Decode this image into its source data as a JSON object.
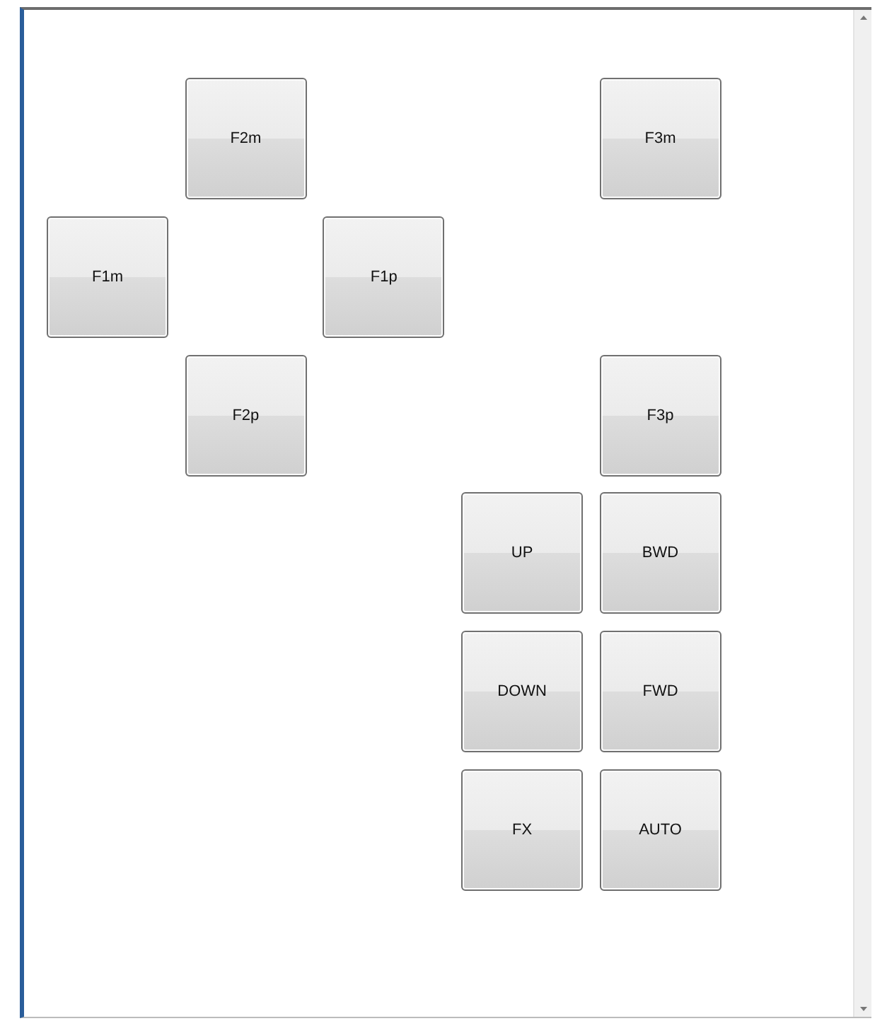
{
  "grid": [
    [
      {
        "kind": "empty"
      },
      {
        "kind": "button",
        "label": "F2m"
      },
      {
        "kind": "empty"
      },
      {
        "kind": "empty"
      },
      {
        "kind": "button",
        "label": "F3m"
      }
    ],
    [
      {
        "kind": "button",
        "label": "F1m"
      },
      {
        "kind": "empty"
      },
      {
        "kind": "button",
        "label": "F1p"
      },
      {
        "kind": "empty"
      },
      {
        "kind": "empty"
      }
    ],
    [
      {
        "kind": "empty"
      },
      {
        "kind": "button",
        "label": "F2p"
      },
      {
        "kind": "empty"
      },
      {
        "kind": "empty"
      },
      {
        "kind": "button",
        "label": "F3p"
      }
    ],
    [
      {
        "kind": "empty"
      },
      {
        "kind": "empty"
      },
      {
        "kind": "empty"
      },
      {
        "kind": "button",
        "label": "UP"
      },
      {
        "kind": "button",
        "label": "BWD"
      }
    ],
    [
      {
        "kind": "empty"
      },
      {
        "kind": "empty"
      },
      {
        "kind": "empty"
      },
      {
        "kind": "button",
        "label": "DOWN"
      },
      {
        "kind": "button",
        "label": "FWD"
      }
    ],
    [
      {
        "kind": "empty"
      },
      {
        "kind": "empty"
      },
      {
        "kind": "empty"
      },
      {
        "kind": "button",
        "label": "FX"
      },
      {
        "kind": "button",
        "label": "AUTO"
      }
    ]
  ]
}
